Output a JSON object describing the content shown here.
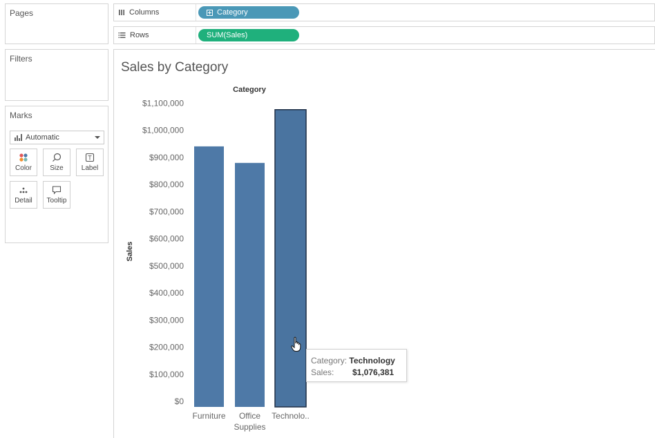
{
  "panes": {
    "pages_title": "Pages",
    "filters_title": "Filters",
    "marks_title": "Marks"
  },
  "marks": {
    "type_value": "Automatic",
    "buttons": [
      {
        "label": "Color",
        "icon": "color-dots-icon"
      },
      {
        "label": "Size",
        "icon": "size-icon"
      },
      {
        "label": "Label",
        "icon": "label-icon"
      },
      {
        "label": "Detail",
        "icon": "detail-dots-icon"
      },
      {
        "label": "Tooltip",
        "icon": "tooltip-bubble-icon"
      }
    ]
  },
  "shelves": {
    "columns_label": "Columns",
    "rows_label": "Rows",
    "columns_pill": "Category",
    "rows_pill": "SUM(Sales)"
  },
  "colors": {
    "bar": "#4e79a7",
    "columns_pill": "#4a98b7",
    "rows_pill": "#1fb07c"
  },
  "viz": {
    "title": "Sales by Category"
  },
  "chart_data": {
    "type": "bar",
    "title": "Sales by Category",
    "column_header": "Category",
    "xlabel": "",
    "ylabel": "Sales",
    "categories": [
      "Furniture",
      "Office Supplies",
      "Technology"
    ],
    "category_labels": [
      [
        "Furniture"
      ],
      [
        "Office",
        "Supplies"
      ],
      [
        "Technolo.."
      ]
    ],
    "values": [
      941000,
      880000,
      1076381
    ],
    "ylim": [
      0,
      1100000
    ],
    "ytick_values": [
      0,
      100000,
      200000,
      300000,
      400000,
      500000,
      600000,
      700000,
      800000,
      900000,
      1000000,
      1100000
    ],
    "ytick_labels": [
      "$0",
      "$100,000",
      "$200,000",
      "$300,000",
      "$400,000",
      "$500,000",
      "$600,000",
      "$700,000",
      "$800,000",
      "$900,000",
      "$1,000,000",
      "$1,100,000"
    ],
    "grid": false,
    "highlighted_index": 2
  },
  "tooltip": {
    "category_key": "Category:",
    "category_value": "Technology",
    "sales_key": "Sales:",
    "sales_value": "$1,076,381"
  }
}
